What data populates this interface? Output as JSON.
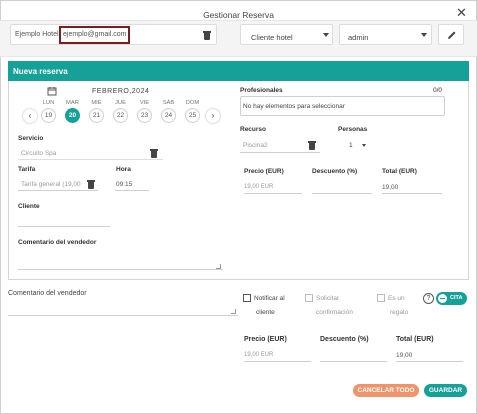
{
  "dialog": {
    "title": "Gestionar Reserva",
    "close_icon": "close-icon"
  },
  "top": {
    "hotel_label": "Ejemplo Hotel",
    "email": "ejemplo@gmail.com",
    "client_type": "Cliente hotel",
    "user": "admin"
  },
  "booking": {
    "header": "Nueva reserva",
    "month": "FEBRERO,2024",
    "days": [
      {
        "name": "LUN",
        "num": "19"
      },
      {
        "name": "MAR",
        "num": "20"
      },
      {
        "name": "MIÉ",
        "num": "21"
      },
      {
        "name": "JUE",
        "num": "22"
      },
      {
        "name": "VIE",
        "num": "23"
      },
      {
        "name": "SÁB",
        "num": "24"
      },
      {
        "name": "DOM",
        "num": "25"
      }
    ],
    "service_label": "Servicio",
    "service_value": "Circuito Spa",
    "rate_label": "Tarifa",
    "rate_value": "Tarifa general (19,00",
    "time_label": "Hora",
    "time_value": "09:15",
    "client_label": "Cliente",
    "seller_comment_label": "Comentario del vendedor",
    "professionals_label": "Profesionales",
    "professionals_count": "0/0",
    "professionals_empty": "No hay elementos para seleccionar",
    "resource_label": "Recurso",
    "resource_value": "Piscina2",
    "persons_label": "Personas",
    "persons_value": "1",
    "price_label": "Precio (EUR)",
    "price_value": "19,00 EUR",
    "discount_label": "Descuento (%)",
    "total_label": "Total (EUR)",
    "total_value": "19,00"
  },
  "footer": {
    "seller_comment_label": "Comentario del vendedor",
    "notify_label_1": "Notificar al",
    "notify_label_2": "cliente",
    "confirm_label_1": "Solicitar",
    "confirm_label_2": "confirmación",
    "gift_label_1": "Es un",
    "gift_label_2": "regalo",
    "help_icon": "?",
    "toggle_label": "CITA",
    "price_label": "Precio (EUR)",
    "price_value": "19,00 EUR",
    "discount_label": "Descuento (%)",
    "total_label": "Total (EUR)",
    "total_value": "19,00",
    "cancel_label": "CANCELAR TODO",
    "save_label": "GUARDAR"
  },
  "colors": {
    "accent": "#16a198",
    "cancel": "#f0956b",
    "highlight": "#7a1e22"
  }
}
